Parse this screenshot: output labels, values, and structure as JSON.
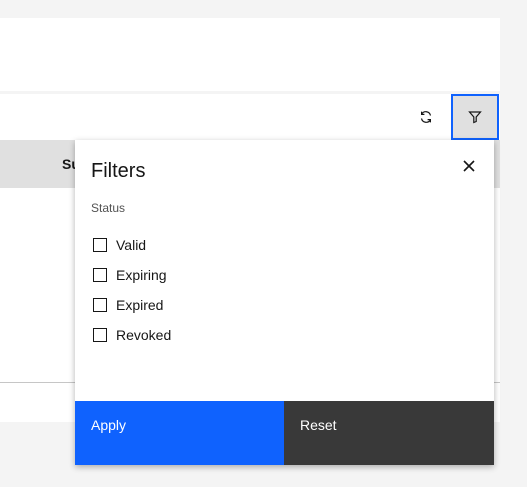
{
  "table": {
    "header_partial": "Su"
  },
  "toolbar": {
    "refresh_icon": "refresh-icon",
    "filter_icon": "filter-icon"
  },
  "filters_panel": {
    "title": "Filters",
    "close_icon": "close-icon",
    "section_label": "Status",
    "options": [
      {
        "label": "Valid",
        "checked": false
      },
      {
        "label": "Expiring",
        "checked": false
      },
      {
        "label": "Expired",
        "checked": false
      },
      {
        "label": "Revoked",
        "checked": false
      }
    ],
    "apply_label": "Apply",
    "reset_label": "Reset"
  },
  "colors": {
    "primary": "#0f62fe",
    "secondary": "#393939",
    "background": "#f4f4f4",
    "header_bg": "#e0e0e0"
  }
}
